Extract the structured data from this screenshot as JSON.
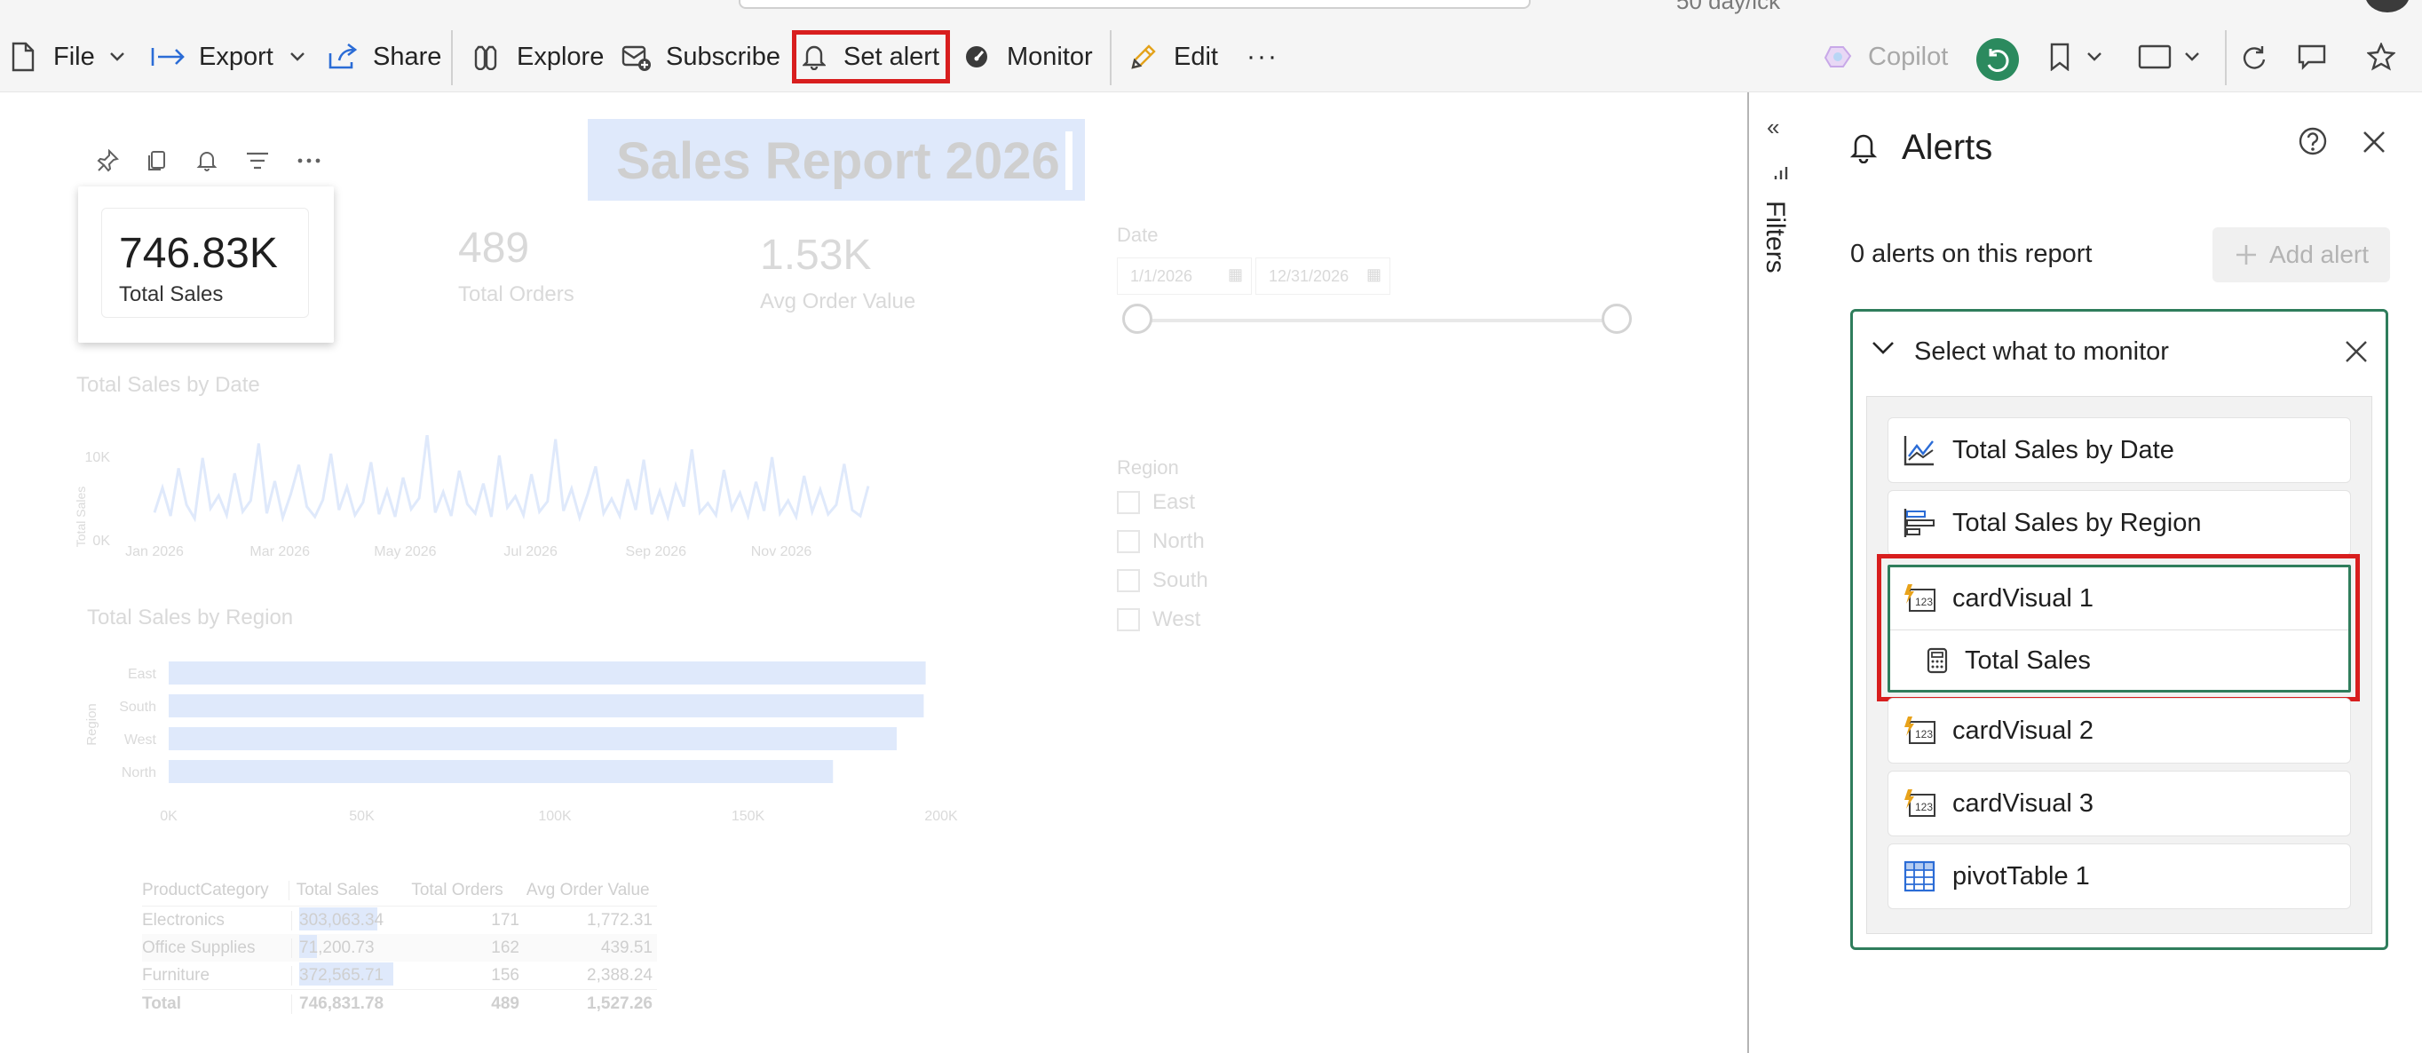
{
  "toolbar": {
    "file": "File",
    "export": "Export",
    "share": "Share",
    "explore": "Explore",
    "subscribe": "Subscribe",
    "set_alert": "Set alert",
    "monitor": "Monitor",
    "edit": "Edit",
    "more": "···",
    "copilot": "Copilot"
  },
  "browser": {
    "partial_text": "50 day/ick"
  },
  "report": {
    "title": "Sales Report 2026",
    "cards": [
      {
        "value": "746.83K",
        "label": "Total Sales"
      },
      {
        "value": "489",
        "label": "Total Orders"
      },
      {
        "value": "1.53K",
        "label": "Avg Order Value"
      }
    ],
    "date_slicer": {
      "label": "Date",
      "start": "1/1/2026",
      "end": "12/31/2026"
    },
    "region_slicer": {
      "label": "Region",
      "options": [
        "East",
        "North",
        "South",
        "West"
      ]
    },
    "line_chart": {
      "title": "Total Sales by Date",
      "ylabel": "Total Sales",
      "yticks": [
        "10K",
        "0K"
      ],
      "xticks": [
        "Jan 2026",
        "Mar 2026",
        "May 2026",
        "Jul 2026",
        "Sep 2026",
        "Nov 2026"
      ]
    },
    "bar_chart": {
      "title": "Total Sales by Region",
      "ylabel": "Region",
      "xticks": [
        "0K",
        "50K",
        "100K",
        "150K",
        "200K"
      ]
    },
    "table": {
      "headers": [
        "ProductCategory",
        "Total Sales",
        "Total Orders",
        "Avg Order Value"
      ],
      "rows": [
        [
          "Electronics",
          "303,063.34",
          "171",
          "1,772.31"
        ],
        [
          "Office Supplies",
          "71,200.73",
          "162",
          "439.51"
        ],
        [
          "Furniture",
          "372,565.71",
          "156",
          "2,388.24"
        ]
      ],
      "total": [
        "Total",
        "746,831.78",
        "489",
        "1,527.26"
      ]
    }
  },
  "chart_data": [
    {
      "type": "line",
      "title": "Total Sales by Date",
      "ylabel": "Total Sales",
      "ylim": [
        0,
        10000
      ],
      "xlim": [
        "2026-01-01",
        "2026-12-31"
      ],
      "series": [
        {
          "values": [
            3200,
            6100,
            2800,
            8400,
            4100,
            2500,
            9600,
            3700,
            5200,
            2900,
            7800,
            3300,
            4600,
            11300,
            3100,
            6900,
            2600,
            5400,
            8800,
            3900,
            2700,
            4700,
            10100,
            3500,
            6200,
            2900,
            4400,
            9100,
            3000,
            5800,
            2700,
            7300,
            3600,
            4900,
            12400,
            3200,
            5600,
            2800,
            8100,
            4200,
            3100,
            6600,
            2700,
            9900,
            3800,
            5100,
            2900,
            7700,
            3300,
            4500,
            11800,
            3400,
            6000,
            2600,
            5300,
            8600,
            3100,
            4800,
            2800,
            7100,
            3500,
            9400,
            3000,
            5700,
            2700,
            6400,
            3900,
            10600,
            3200,
            4300,
            2900,
            8200,
            3600,
            5500,
            2800,
            6800,
            3400,
            9700,
            3100,
            4600,
            2700,
            7500,
            3300,
            5900,
            3000,
            4100,
            8900,
            3500,
            2800,
            6300
          ]
        }
      ]
    },
    {
      "type": "bar",
      "title": "Total Sales by Region",
      "ylabel": "Region",
      "categories": [
        "East",
        "South",
        "West",
        "North"
      ],
      "values": [
        196000,
        195500,
        188500,
        172000
      ],
      "xlim": [
        0,
        200000
      ]
    }
  ],
  "filters": {
    "label": "Filters"
  },
  "alerts": {
    "title": "Alerts",
    "count_text": "0 alerts on this report",
    "add_alert": "Add alert",
    "select_header": "Select what to monitor",
    "items": [
      "Total Sales by Date",
      "Total Sales by Region",
      "cardVisual 1",
      "Total Sales",
      "cardVisual 2",
      "cardVisual 3",
      "pivotTable 1"
    ]
  },
  "colors": {
    "accent_red": "#d81e1e",
    "teal_border": "#2f7d5c",
    "copilot_avatar": "#2b8a5e",
    "faint_blue": "#dfe9fb"
  }
}
